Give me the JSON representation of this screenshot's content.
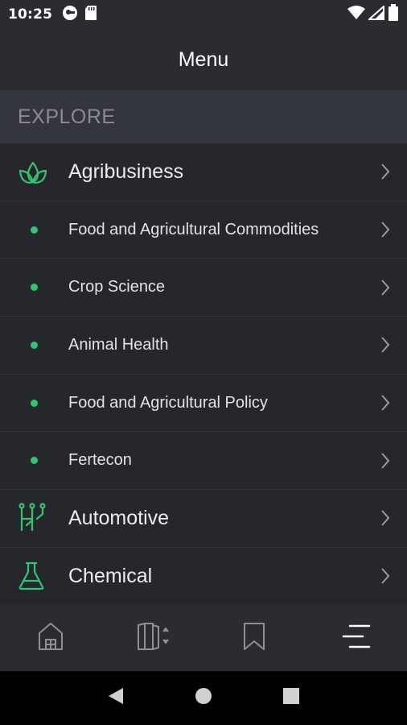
{
  "status_bar": {
    "time": "10:25",
    "left_icons": [
      "vpn-key-icon",
      "sd-card-icon"
    ],
    "right_icons": [
      "wifi-icon",
      "signal-icon",
      "battery-icon"
    ]
  },
  "app_bar": {
    "title": "Menu"
  },
  "section": {
    "label": "EXPLORE"
  },
  "menu": {
    "items": [
      {
        "label": "Agribusiness",
        "icon": "leaf-sprout-icon",
        "level": "top"
      },
      {
        "label": "Food and Agricultural Commodities",
        "icon": "bullet-dot-icon",
        "level": "sub"
      },
      {
        "label": "Crop Science",
        "icon": "bullet-dot-icon",
        "level": "sub"
      },
      {
        "label": "Animal Health",
        "icon": "bullet-dot-icon",
        "level": "sub"
      },
      {
        "label": "Food and Agricultural Policy",
        "icon": "bullet-dot-icon",
        "level": "sub"
      },
      {
        "label": "Fertecon",
        "icon": "bullet-dot-icon",
        "level": "sub"
      },
      {
        "label": "Automotive",
        "icon": "circuit-icon",
        "level": "top"
      },
      {
        "label": "Chemical",
        "icon": "flask-icon",
        "level": "top"
      }
    ]
  },
  "bottom_nav": {
    "items": [
      {
        "icon": "home-icon",
        "active": false
      },
      {
        "icon": "book-sort-icon",
        "active": false
      },
      {
        "icon": "bookmark-icon",
        "active": false
      },
      {
        "icon": "menu-icon",
        "active": true
      }
    ]
  },
  "system_nav": {
    "icons": [
      "back-icon",
      "home-circle-icon",
      "recents-icon"
    ]
  },
  "colors": {
    "accent": "#2ec66e",
    "background": "#26272c",
    "bar": "#2b2c30",
    "section": "#33363d"
  }
}
